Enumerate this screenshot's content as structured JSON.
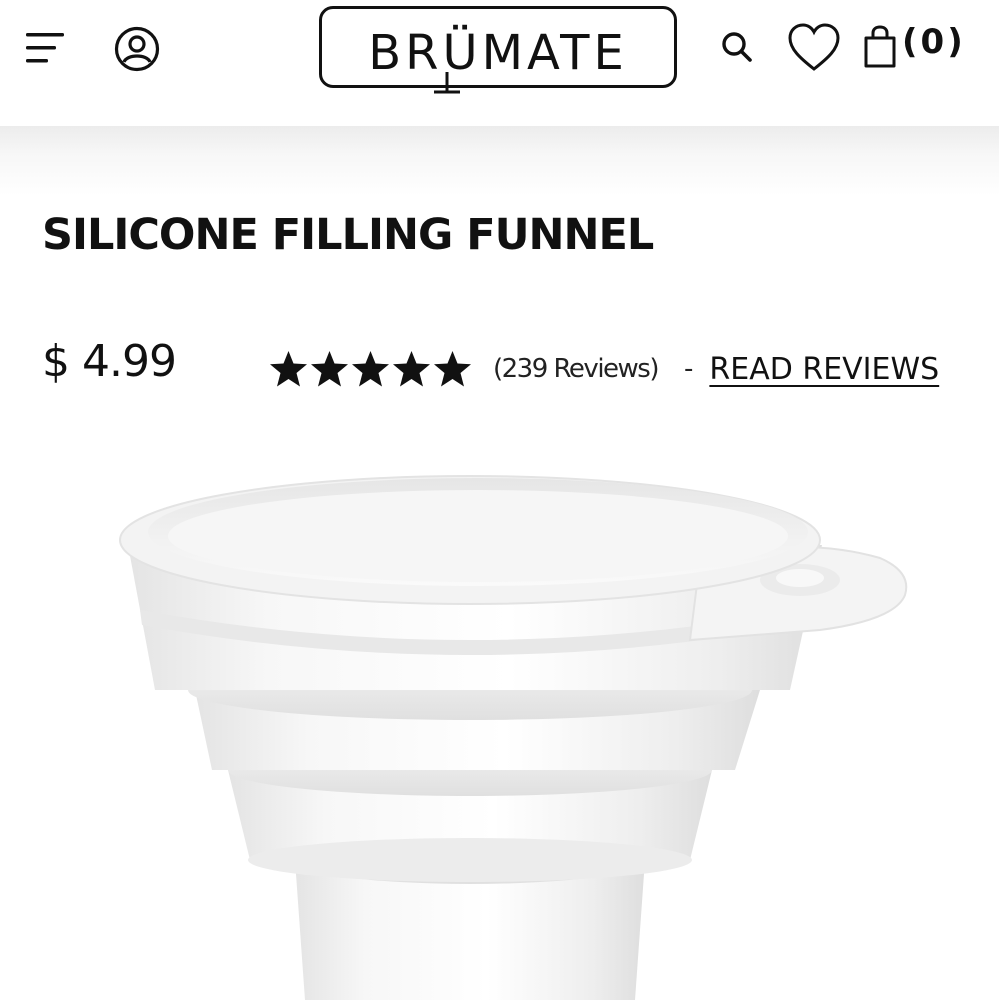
{
  "header": {
    "brand": "BRÜMATE",
    "cart_count": "(0)"
  },
  "icons": {
    "menu": "hamburger-menu-icon",
    "account": "user-account-icon",
    "search": "search-icon",
    "wishlist": "heart-icon",
    "cart": "shopping-bag-icon",
    "rating": "star-icon"
  },
  "product": {
    "title": "SILICONE FILLING FUNNEL",
    "price": "$ 4.99",
    "rating": 5,
    "rating_max": 5,
    "review_count": "(239 Reviews)",
    "separator": "-",
    "read_reviews": "READ REVIEWS",
    "image_alt": "White collapsible silicone funnel"
  },
  "colors": {
    "text": "#111111",
    "background": "#ffffff",
    "header_shadow": "#ececec"
  }
}
